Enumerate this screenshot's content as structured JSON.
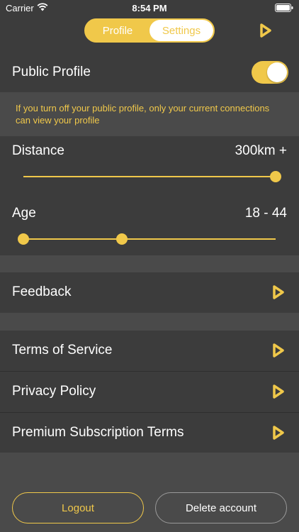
{
  "status_bar": {
    "carrier": "Carrier",
    "time": "8:54 PM"
  },
  "header": {
    "tabs": [
      {
        "label": "Profile",
        "selected": false
      },
      {
        "label": "Settings",
        "selected": true
      }
    ],
    "next_icon": "play-chevron-icon"
  },
  "public_profile": {
    "label": "Public Profile",
    "enabled": true,
    "notice": "If you turn off your public profile, only your current connections can view your profile"
  },
  "distance": {
    "label": "Distance",
    "value": "300km +",
    "level": 1.0
  },
  "age": {
    "label": "Age",
    "value": "18 - 44",
    "low_level": 0.0,
    "high_level": 0.39
  },
  "menu": {
    "feedback": "Feedback",
    "terms": "Terms of Service",
    "privacy": "Privacy Policy",
    "premium": "Premium Subscription Terms"
  },
  "buttons": {
    "logout": "Logout",
    "delete": "Delete account"
  },
  "colors": {
    "accent": "#f0c84a",
    "background": "#3c3c3c",
    "section_gap": "#4a4a4a"
  }
}
